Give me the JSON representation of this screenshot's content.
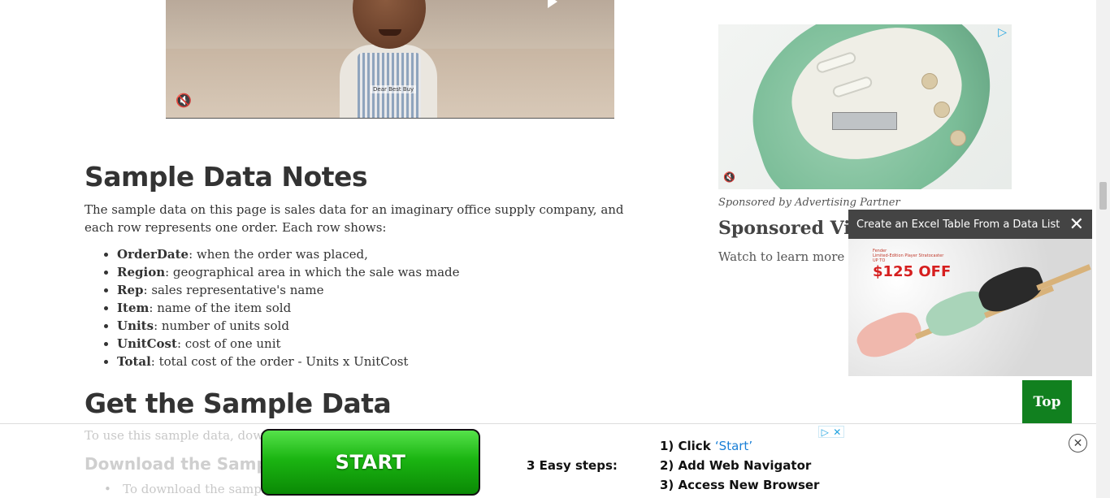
{
  "video": {
    "tag": "Dear Best Buy",
    "mute_icon": "muted-speaker-icon"
  },
  "article": {
    "notes_heading": "Sample Data Notes",
    "intro": "The sample data on this page is sales data for an imaginary office supply company, and each row represents one order. Each row shows:",
    "fields": [
      {
        "name": "OrderDate",
        "desc": ": when the order was placed,"
      },
      {
        "name": "Region",
        "desc": ": geographical area in which the sale was made"
      },
      {
        "name": "Rep",
        "desc": ": sales representative's name"
      },
      {
        "name": "Item",
        "desc": ": name of the item sold"
      },
      {
        "name": "Units",
        "desc": ": number of units sold"
      },
      {
        "name": "UnitCost",
        "desc": ": cost of one unit"
      },
      {
        "name": "Total",
        "desc": ": total cost of the order - Units x UnitCost"
      }
    ],
    "get_heading": "Get the Sample Data",
    "faded_paragraph": "To use this sample data, dowi",
    "faded_subheading": "Download the Sample",
    "faded_item": "To download the sample"
  },
  "sidebar": {
    "sponsored_by": "Sponsored by Advertising Partner",
    "sponsored_title": "Sponsored Vid",
    "watch_text": "Watch to learn more"
  },
  "floating_video": {
    "title": "Create an Excel Table From a Data List",
    "close": "✕",
    "brand_line1": "Fender",
    "brand_line2": "Limited-Edition Player Stratocaster",
    "brand_line3": "UP TO",
    "price": "$125 OFF"
  },
  "top_button": "Top",
  "bottom_ad": {
    "start_label": "START",
    "steps_label": "3 Easy steps:",
    "step1_prefix": "1) Click ",
    "step1_highlight": "‘Start’",
    "step2": "2) Add  Web Navigator",
    "step3": "3) Access New Browser",
    "close": "✕"
  },
  "colors": {
    "top_button": "#11801f",
    "start_green": "#1bb512",
    "adchoice_blue": "#1fa3e0"
  }
}
